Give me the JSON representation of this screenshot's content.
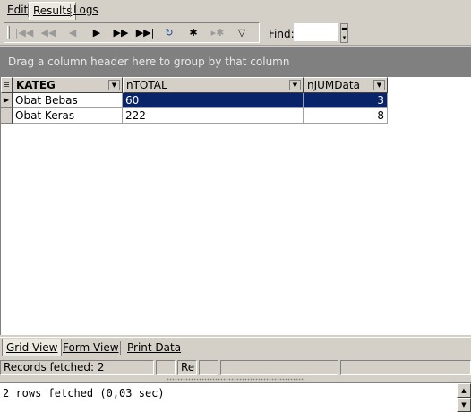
{
  "tabs": {
    "edit": "Edit",
    "results": "Results",
    "logs": "Logs"
  },
  "toolbar": {
    "buttons": [
      {
        "name": "first-record",
        "glyph": "⏮",
        "enabled": false
      },
      {
        "name": "prior-page",
        "glyph": "⏪",
        "enabled": false
      },
      {
        "name": "prior-record",
        "glyph": "◀",
        "enabled": false
      },
      {
        "name": "next-record",
        "glyph": "▶",
        "enabled": true
      },
      {
        "name": "next-page",
        "glyph": "⏩",
        "enabled": true
      },
      {
        "name": "last-record",
        "glyph": "⏭",
        "enabled": true
      },
      {
        "name": "refresh",
        "glyph": "↻",
        "enabled": true
      },
      {
        "name": "insert-record",
        "glyph": "✱",
        "enabled": true
      },
      {
        "name": "delete-record",
        "glyph": "✱",
        "enabled": false
      },
      {
        "name": "filter",
        "glyph": "⛛",
        "enabled": true
      }
    ],
    "find_label": "Find:",
    "find_value": ""
  },
  "group_panel": {
    "hint": "Drag a column header here to group by that column"
  },
  "grid": {
    "columns": [
      "KATEG",
      "nTOTAL",
      "nJUMData"
    ],
    "rows": [
      [
        "Obat Bebas",
        "60",
        "3"
      ],
      [
        "Obat Keras",
        "222",
        "8"
      ]
    ],
    "selected_row": 0
  },
  "view_tabs": {
    "grid": "Grid View",
    "form": "Form View",
    "print": "Print Data"
  },
  "status": {
    "records": "Records fetched: 2",
    "mode": "Re"
  },
  "log": {
    "text": "2 rows fetched (0,03 sec)"
  },
  "colors": {
    "selection": "#0a246a",
    "group_panel": "#808080",
    "face": "#d4d0c8"
  }
}
